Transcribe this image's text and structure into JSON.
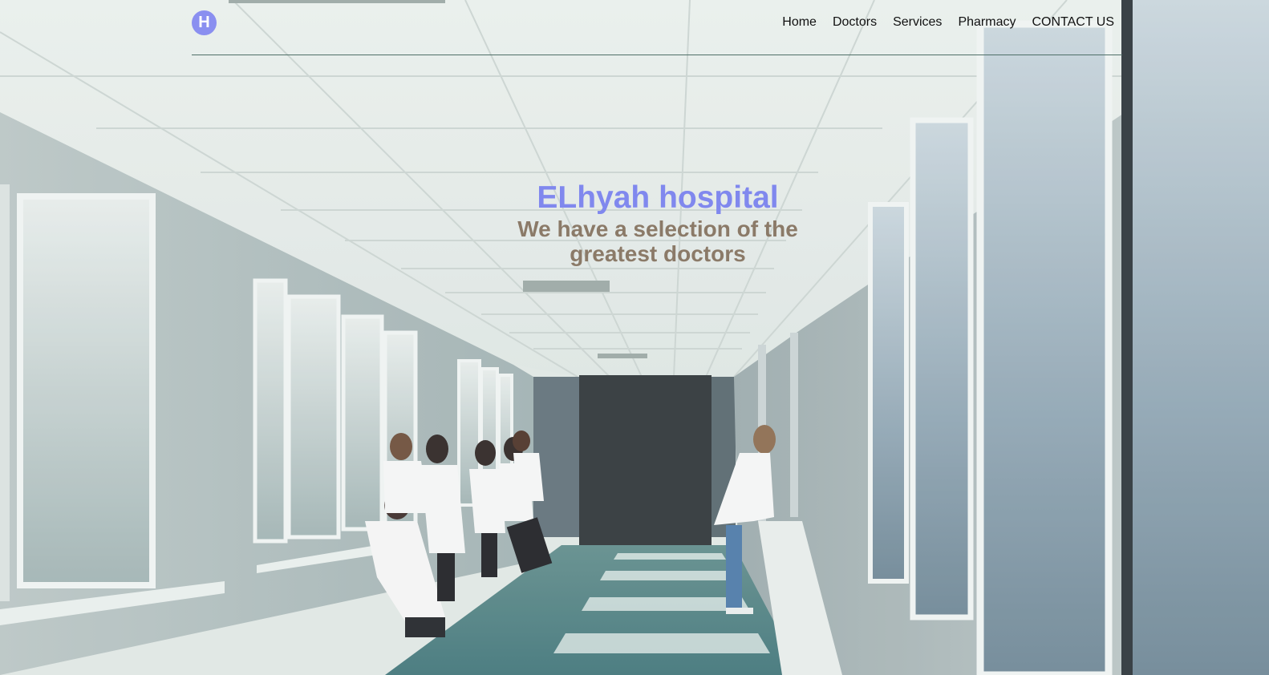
{
  "header": {
    "logo_letter": "H",
    "nav": [
      "Home",
      "Doctors",
      "Services",
      "Pharmacy",
      "CONTACT US"
    ]
  },
  "hero": {
    "title": "ELhyah hospital",
    "subtitle": "We have a selection of the greatest doctors"
  },
  "colors": {
    "accent": "#8088ee",
    "subtitle": "#8b7a68",
    "nav_text": "#111111",
    "divider": "#4f6f68"
  }
}
